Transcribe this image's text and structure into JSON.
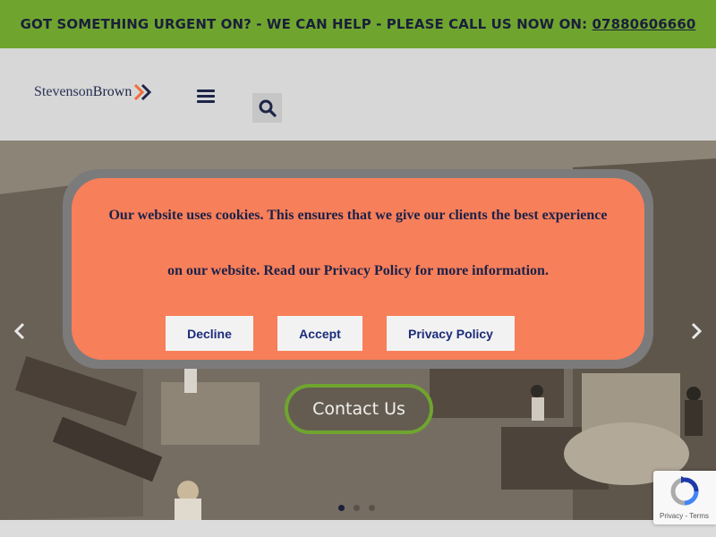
{
  "topbar": {
    "message": "GOT SOMETHING URGENT ON? - WE CAN HELP - PLEASE CALL US NOW ON: ",
    "phone": "07880606660"
  },
  "header": {
    "logo_part1": "Stevenson",
    "logo_part2": "Brown",
    "menu_icon": "hamburger-menu-icon",
    "search_icon": "search-icon"
  },
  "hero": {
    "contact_label": "Contact Us",
    "slides_count": 3,
    "active_slide": 1
  },
  "cookie": {
    "line1": "Our website uses cookies. This ensures that we give our clients the best experience",
    "line2": "on our website. Read our Privacy Policy for more information.",
    "decline_label": "Decline",
    "accept_label": "Accept",
    "privacy_label": "Privacy Policy"
  },
  "recaptcha": {
    "privacy": "Privacy",
    "separator": " - ",
    "terms": "Terms"
  },
  "colors": {
    "topbar_bg": "#6fa52f",
    "cookie_bg": "#f77f5a",
    "navy": "#1c2248"
  }
}
